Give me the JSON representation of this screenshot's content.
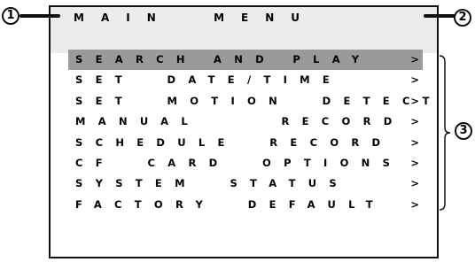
{
  "screen": {
    "title": "MAIN  MENU",
    "items": [
      {
        "label": "SEARCH AND PLAY",
        "arrow": ">",
        "selected": true
      },
      {
        "label": "SET  DATE/TIME",
        "arrow": ">",
        "selected": false
      },
      {
        "label": "SET  MOTION  DETECT",
        "arrow": ">",
        "selected": false
      },
      {
        "label": "MANUAL     RECORD",
        "arrow": ">",
        "selected": false
      },
      {
        "label": "SCHEDULE  RECORD",
        "arrow": ">",
        "selected": false
      },
      {
        "label": "CF  CARD  OPTIONS",
        "arrow": ">",
        "selected": false
      },
      {
        "label": "SYSTEM  STATUS",
        "arrow": ">",
        "selected": false
      },
      {
        "label": "FACTORY  DEFAULT",
        "arrow": ">",
        "selected": false
      }
    ]
  },
  "callouts": [
    {
      "number": "1"
    },
    {
      "number": "2"
    },
    {
      "number": "3"
    }
  ],
  "colors": {
    "selection_highlight": "#9a9a9a",
    "header_band": "#ececec",
    "frame": "#111111"
  }
}
